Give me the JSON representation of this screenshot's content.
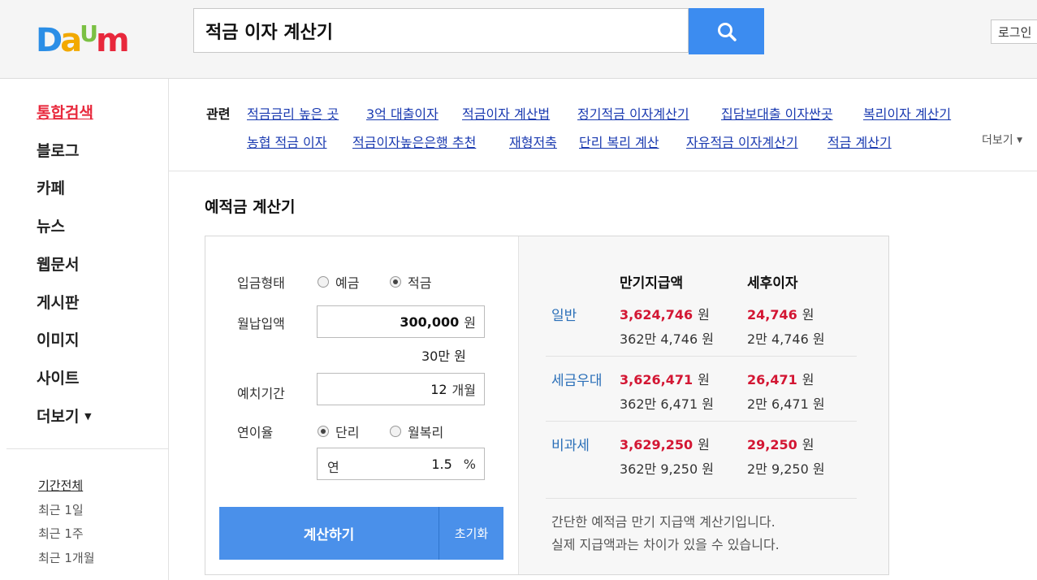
{
  "header": {
    "logo": [
      "D",
      "a",
      "U",
      "m"
    ],
    "logo_colors": [
      "#2b8ee6",
      "#f2a900",
      "#7bc043",
      "#e8283c"
    ],
    "search_value": "적금 이자 계산기",
    "login": "로그인"
  },
  "sidebar": {
    "nav": [
      "통합검색",
      "블로그",
      "카페",
      "뉴스",
      "웹문서",
      "게시판",
      "이미지",
      "사이트",
      "더보기"
    ],
    "periods": [
      "기간전체",
      "최근 1일",
      "최근 1주",
      "최근 1개월"
    ]
  },
  "related": {
    "title": "관련",
    "row1": [
      "적금금리 높은 곳",
      "3억 대출이자",
      "적금이자 계산법",
      "정기적금 이자계산기",
      "집담보대출 이자싼곳",
      "복리이자 계산기"
    ],
    "row2": [
      "농협 적금 이자",
      "적금이자높은은행 추천",
      "재형저축",
      "단리 복리 계산",
      "자유적금 이자계산기",
      "적금 계산기"
    ],
    "more": "더보기"
  },
  "calc": {
    "title": "예적금 계산기",
    "deposit_type_label": "입금형태",
    "deposit_options": [
      "예금",
      "적금"
    ],
    "monthly_label": "월납입액",
    "monthly_value": "300,000",
    "won": "원",
    "monthly_korean": "30만  원",
    "period_label": "예치기간",
    "period_value": "12",
    "period_unit": "개월",
    "rate_label": "연이율",
    "rate_options": [
      "단리",
      "월복리"
    ],
    "rate_prefix": "연",
    "rate_value": "1.5",
    "rate_unit": "%",
    "calc_button": "계산하기",
    "reset_button": "초기화"
  },
  "results": {
    "col1": "만기지급액",
    "col2": "세후이자",
    "won": "원",
    "rows": [
      {
        "label": "일반",
        "total": "3,624,746",
        "total_kr": "362만 4,746 원",
        "interest": "24,746",
        "interest_kr": "2만 4,746 원"
      },
      {
        "label": "세금우대",
        "total": "3,626,471",
        "total_kr": "362만 6,471 원",
        "interest": "26,471",
        "interest_kr": "2만 6,471 원"
      },
      {
        "label": "비과세",
        "total": "3,629,250",
        "total_kr": "362만 9,250 원",
        "interest": "29,250",
        "interest_kr": "2만 9,250 원"
      }
    ],
    "note1": "간단한 예적금 만기 지급액 계산기입니다.",
    "note2": "실제 지급액과는 차이가 있을 수 있습니다."
  }
}
